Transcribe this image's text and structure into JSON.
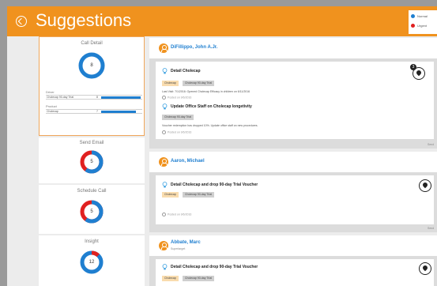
{
  "header": {
    "title": "Suggestions",
    "legend": [
      {
        "label": "Normal",
        "color": "#1f7fd0"
      },
      {
        "label": "Urgent",
        "color": "#e02020"
      }
    ]
  },
  "left_panel": {
    "call_detail": {
      "title": "Call Detail",
      "count": "8",
      "groups": [
        {
          "label": "Driver",
          "rows": [
            {
              "name": "Cholecap 90-day Trial",
              "count": "8"
            }
          ]
        },
        {
          "label": "Product",
          "rows": [
            {
              "name": "Cholecap",
              "count": "7"
            }
          ]
        }
      ]
    },
    "send_email": {
      "title": "Send Email",
      "count": "5",
      "urgent_fraction": 0.4
    },
    "schedule_call": {
      "title": "Schedule Call",
      "count": "5",
      "urgent_fraction": 0.4
    },
    "insight": {
      "title": "Insight",
      "count": "12",
      "urgent_fraction": 0.1
    }
  },
  "colors": {
    "accent": "#f0921e",
    "normal": "#1f7fd0",
    "urgent": "#e02020"
  },
  "persons": [
    {
      "name": "DiFillippo, John A.Jr.",
      "badge": "3",
      "suggestions": [
        {
          "title": "Detail Cholecap",
          "tags": [
            "Cholecap",
            "Cholecap 90-day Trial"
          ],
          "description": "Last Visit: 7/1/2016: Opened Cholecap Efficacy in children on 6/11/2016",
          "posted": "Posted on 9/6/2016"
        },
        {
          "title": "Update Office Staff on Cholecap longetivity",
          "tags": [
            "Cholecap 90-day Trial"
          ],
          "description": "Voucher redemption has dropped 10%. Update office staff on new procedures.",
          "posted": "Posted on 9/6/2016"
        }
      ],
      "send_label": "Send"
    },
    {
      "name": "Aaron, Michael",
      "suggestions": [
        {
          "title": "Detail Cholecap and drop 90-day Trial Voucher",
          "tags": [
            "Cholecap",
            "Cholecap 90-day Trial"
          ],
          "description": "",
          "posted": "Posted on 9/6/2016"
        }
      ],
      "send_label": "Send"
    },
    {
      "name": "Abbate, Marc",
      "subtitle": "Supertarget",
      "suggestions": [
        {
          "title": "Detail Cholecap and drop 90-day Trial Voucher",
          "tags": [
            "Cholecap",
            "Cholecap 90-day Trial"
          ],
          "description": "",
          "posted": ""
        }
      ]
    }
  ]
}
